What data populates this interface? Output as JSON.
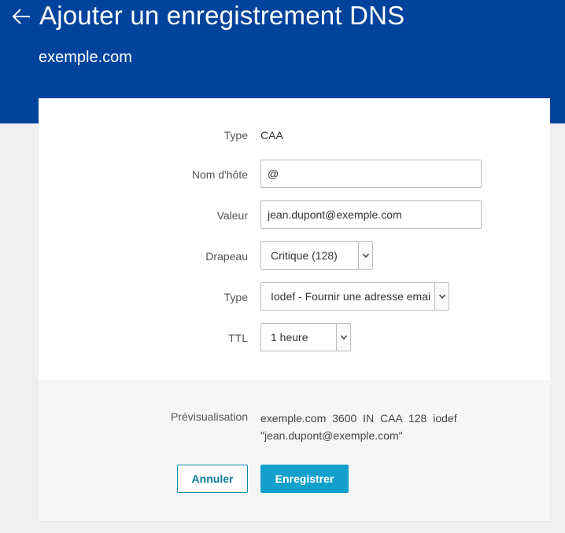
{
  "header": {
    "back_icon": "arrow-left-icon",
    "title": "Ajouter un enregistrement DNS",
    "subtitle": "exemple.com"
  },
  "form": {
    "type_label": "Type",
    "type_value": "CAA",
    "hostname_label": "Nom d'hôte",
    "hostname_value": "@",
    "value_label": "Valeur",
    "value_value": "jean.dupont@exemple.com",
    "flag_label": "Drapeau",
    "flag_selected": "Critique (128)",
    "tag_type_label": "Type",
    "tag_type_selected": "Iodef - Fournir une adresse email",
    "ttl_label": "TTL",
    "ttl_selected": "1 heure"
  },
  "preview": {
    "label": "Prévisualisation",
    "text": "exemple.com 3600 IN CAA 128 iodef \"jean.dupont@exemple.com\""
  },
  "actions": {
    "cancel_label": "Annuler",
    "save_label": "Enregistrer"
  },
  "colors": {
    "header_bg": "#00439c",
    "primary_button": "#14a0cc",
    "page_bg": "#f0f0f0"
  }
}
